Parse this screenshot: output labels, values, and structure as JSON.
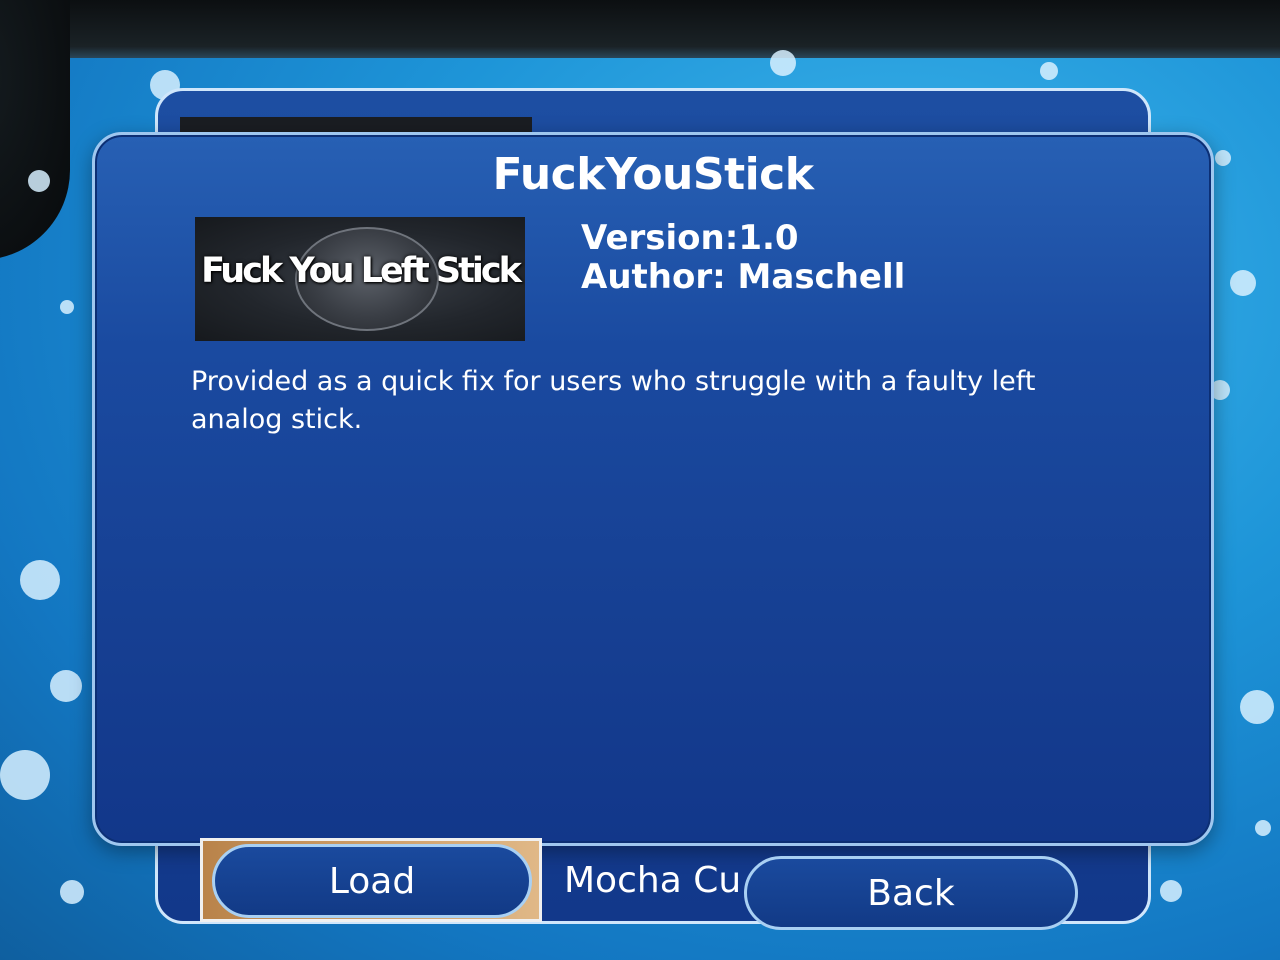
{
  "dialog": {
    "title": "FuckYouStick",
    "thumbnail_text": "Fuck You Left Stick",
    "version_label": "Version:",
    "version_value": "1.0",
    "author_label": "Author:",
    "author_value": "Maschell",
    "description": "Provided as a quick fix for users who struggle with a faulty left analog stick."
  },
  "bottom_bar": {
    "load_label": "Load",
    "list_item_title": "Mocha Cus",
    "back_label": "Back"
  },
  "colors": {
    "background_blue": "#1e95d8",
    "dialog_blue": "#1a4aa0",
    "button_border": "#a9d0f3"
  }
}
